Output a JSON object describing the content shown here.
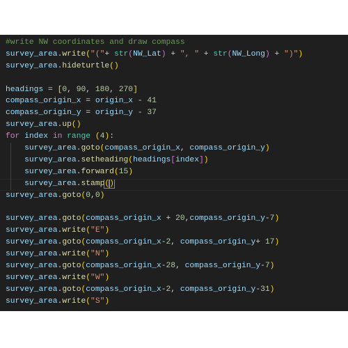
{
  "editor": {
    "language": "python",
    "lines": [
      {
        "indent": 0,
        "tokens": [
          [
            "cm",
            "#write NW coordinates and draw compass"
          ]
        ]
      },
      {
        "indent": 0,
        "tokens": [
          [
            "id",
            "survey_area"
          ],
          [
            "op",
            "."
          ],
          [
            "fn",
            "write"
          ],
          [
            "b1",
            "("
          ],
          [
            "st",
            "\"(\""
          ],
          [
            "op",
            "+ "
          ],
          [
            "bi",
            "str"
          ],
          [
            "b2",
            "("
          ],
          [
            "id",
            "NW_Lat"
          ],
          [
            "b2",
            ")"
          ],
          [
            "op",
            " + "
          ],
          [
            "st",
            "\", \""
          ],
          [
            "op",
            " + "
          ],
          [
            "bi",
            "str"
          ],
          [
            "b2",
            "("
          ],
          [
            "id",
            "NW_Long"
          ],
          [
            "b2",
            ")"
          ],
          [
            "op",
            " + "
          ],
          [
            "st",
            "\")\""
          ],
          [
            "b1",
            ")"
          ]
        ]
      },
      {
        "indent": 0,
        "tokens": [
          [
            "id",
            "survey_area"
          ],
          [
            "op",
            "."
          ],
          [
            "fn",
            "hideturtle"
          ],
          [
            "b1",
            "()"
          ]
        ]
      },
      {
        "indent": 0,
        "tokens": []
      },
      {
        "indent": 0,
        "tokens": [
          [
            "id",
            "headings"
          ],
          [
            "op",
            " = "
          ],
          [
            "b1",
            "["
          ],
          [
            "nu",
            "0"
          ],
          [
            "op",
            ", "
          ],
          [
            "nu",
            "90"
          ],
          [
            "op",
            ", "
          ],
          [
            "nu",
            "180"
          ],
          [
            "op",
            ", "
          ],
          [
            "nu",
            "270"
          ],
          [
            "b1",
            "]"
          ]
        ]
      },
      {
        "indent": 0,
        "tokens": [
          [
            "id",
            "compass_origin_x"
          ],
          [
            "op",
            " = "
          ],
          [
            "id",
            "origin_x"
          ],
          [
            "op",
            " - "
          ],
          [
            "nu",
            "41"
          ]
        ]
      },
      {
        "indent": 0,
        "tokens": [
          [
            "id",
            "compass_origin_y"
          ],
          [
            "op",
            " = "
          ],
          [
            "id",
            "origin_y"
          ],
          [
            "op",
            " - "
          ],
          [
            "nu",
            "37"
          ]
        ]
      },
      {
        "indent": 0,
        "tokens": [
          [
            "id",
            "survey_area"
          ],
          [
            "op",
            "."
          ],
          [
            "fn",
            "up"
          ],
          [
            "b1",
            "()"
          ]
        ]
      },
      {
        "indent": 0,
        "tokens": [
          [
            "kw",
            "for"
          ],
          [
            "op",
            " "
          ],
          [
            "id",
            "index"
          ],
          [
            "op",
            " "
          ],
          [
            "kw",
            "in"
          ],
          [
            "op",
            " "
          ],
          [
            "bi",
            "range"
          ],
          [
            "op",
            " "
          ],
          [
            "b1",
            "("
          ],
          [
            "nu",
            "4"
          ],
          [
            "b1",
            ")"
          ],
          [
            "op",
            ":"
          ]
        ]
      },
      {
        "indent": 1,
        "tokens": [
          [
            "id",
            "survey_area"
          ],
          [
            "op",
            "."
          ],
          [
            "fn",
            "goto"
          ],
          [
            "b1",
            "("
          ],
          [
            "id",
            "compass_origin_x"
          ],
          [
            "op",
            ", "
          ],
          [
            "id",
            "compass_origin_y"
          ],
          [
            "b1",
            ")"
          ]
        ]
      },
      {
        "indent": 1,
        "tokens": [
          [
            "id",
            "survey_area"
          ],
          [
            "op",
            "."
          ],
          [
            "fn",
            "setheading"
          ],
          [
            "b1",
            "("
          ],
          [
            "id",
            "headings"
          ],
          [
            "b2",
            "["
          ],
          [
            "id",
            "index"
          ],
          [
            "b2",
            "]"
          ],
          [
            "b1",
            ")"
          ]
        ]
      },
      {
        "indent": 1,
        "tokens": [
          [
            "id",
            "survey_area"
          ],
          [
            "op",
            "."
          ],
          [
            "fn",
            "forward"
          ],
          [
            "b1",
            "("
          ],
          [
            "nu",
            "15"
          ],
          [
            "b1",
            ")"
          ]
        ]
      },
      {
        "indent": 1,
        "current": true,
        "tokens": [
          [
            "id",
            "survey_area"
          ],
          [
            "op",
            "."
          ],
          [
            "fn",
            "stamp"
          ],
          [
            "b1 bm",
            "("
          ],
          [
            "b1 bm",
            ")"
          ]
        ]
      },
      {
        "indent": 0,
        "tokens": [
          [
            "id",
            "survey_area"
          ],
          [
            "op",
            "."
          ],
          [
            "fn",
            "goto"
          ],
          [
            "b1",
            "("
          ],
          [
            "nu",
            "0"
          ],
          [
            "op",
            ","
          ],
          [
            "nu",
            "0"
          ],
          [
            "b1",
            ")"
          ]
        ]
      },
      {
        "indent": 0,
        "tokens": []
      },
      {
        "indent": 0,
        "tokens": [
          [
            "id",
            "survey_area"
          ],
          [
            "op",
            "."
          ],
          [
            "fn",
            "goto"
          ],
          [
            "b1",
            "("
          ],
          [
            "id",
            "compass_origin_x"
          ],
          [
            "op",
            " + "
          ],
          [
            "nu",
            "20"
          ],
          [
            "op",
            ","
          ],
          [
            "id",
            "compass_origin_y"
          ],
          [
            "op",
            "-"
          ],
          [
            "nu",
            "7"
          ],
          [
            "b1",
            ")"
          ]
        ]
      },
      {
        "indent": 0,
        "tokens": [
          [
            "id",
            "survey_area"
          ],
          [
            "op",
            "."
          ],
          [
            "fn",
            "write"
          ],
          [
            "b1",
            "("
          ],
          [
            "st",
            "\"E\""
          ],
          [
            "b1",
            ")"
          ]
        ]
      },
      {
        "indent": 0,
        "tokens": [
          [
            "id",
            "survey_area"
          ],
          [
            "op",
            "."
          ],
          [
            "fn",
            "goto"
          ],
          [
            "b1",
            "("
          ],
          [
            "id",
            "compass_origin_x"
          ],
          [
            "op",
            "-"
          ],
          [
            "nu",
            "2"
          ],
          [
            "op",
            ", "
          ],
          [
            "id",
            "compass_origin_y"
          ],
          [
            "op",
            "+ "
          ],
          [
            "nu",
            "17"
          ],
          [
            "b1",
            ")"
          ]
        ]
      },
      {
        "indent": 0,
        "tokens": [
          [
            "id",
            "survey_area"
          ],
          [
            "op",
            "."
          ],
          [
            "fn",
            "write"
          ],
          [
            "b1",
            "("
          ],
          [
            "st",
            "\"N\""
          ],
          [
            "b1",
            ")"
          ]
        ]
      },
      {
        "indent": 0,
        "tokens": [
          [
            "id",
            "survey_area"
          ],
          [
            "op",
            "."
          ],
          [
            "fn",
            "goto"
          ],
          [
            "b1",
            "("
          ],
          [
            "id",
            "compass_origin_x"
          ],
          [
            "op",
            "-"
          ],
          [
            "nu",
            "28"
          ],
          [
            "op",
            ", "
          ],
          [
            "id",
            "compass_origin_y"
          ],
          [
            "op",
            "-"
          ],
          [
            "nu",
            "7"
          ],
          [
            "b1",
            ")"
          ]
        ]
      },
      {
        "indent": 0,
        "tokens": [
          [
            "id",
            "survey_area"
          ],
          [
            "op",
            "."
          ],
          [
            "fn",
            "write"
          ],
          [
            "b1",
            "("
          ],
          [
            "st",
            "\"W\""
          ],
          [
            "b1",
            ")"
          ]
        ]
      },
      {
        "indent": 0,
        "tokens": [
          [
            "id",
            "survey_area"
          ],
          [
            "op",
            "."
          ],
          [
            "fn",
            "goto"
          ],
          [
            "b1",
            "("
          ],
          [
            "id",
            "compass_origin_x"
          ],
          [
            "op",
            "-"
          ],
          [
            "nu",
            "2"
          ],
          [
            "op",
            ", "
          ],
          [
            "id",
            "compass_origin_y"
          ],
          [
            "op",
            "-"
          ],
          [
            "nu",
            "31"
          ],
          [
            "b1",
            ")"
          ]
        ]
      },
      {
        "indent": 0,
        "tokens": [
          [
            "id",
            "survey_area"
          ],
          [
            "op",
            "."
          ],
          [
            "fn",
            "write"
          ],
          [
            "b1",
            "("
          ],
          [
            "st",
            "\"S\""
          ],
          [
            "b1",
            ")"
          ]
        ]
      }
    ]
  }
}
